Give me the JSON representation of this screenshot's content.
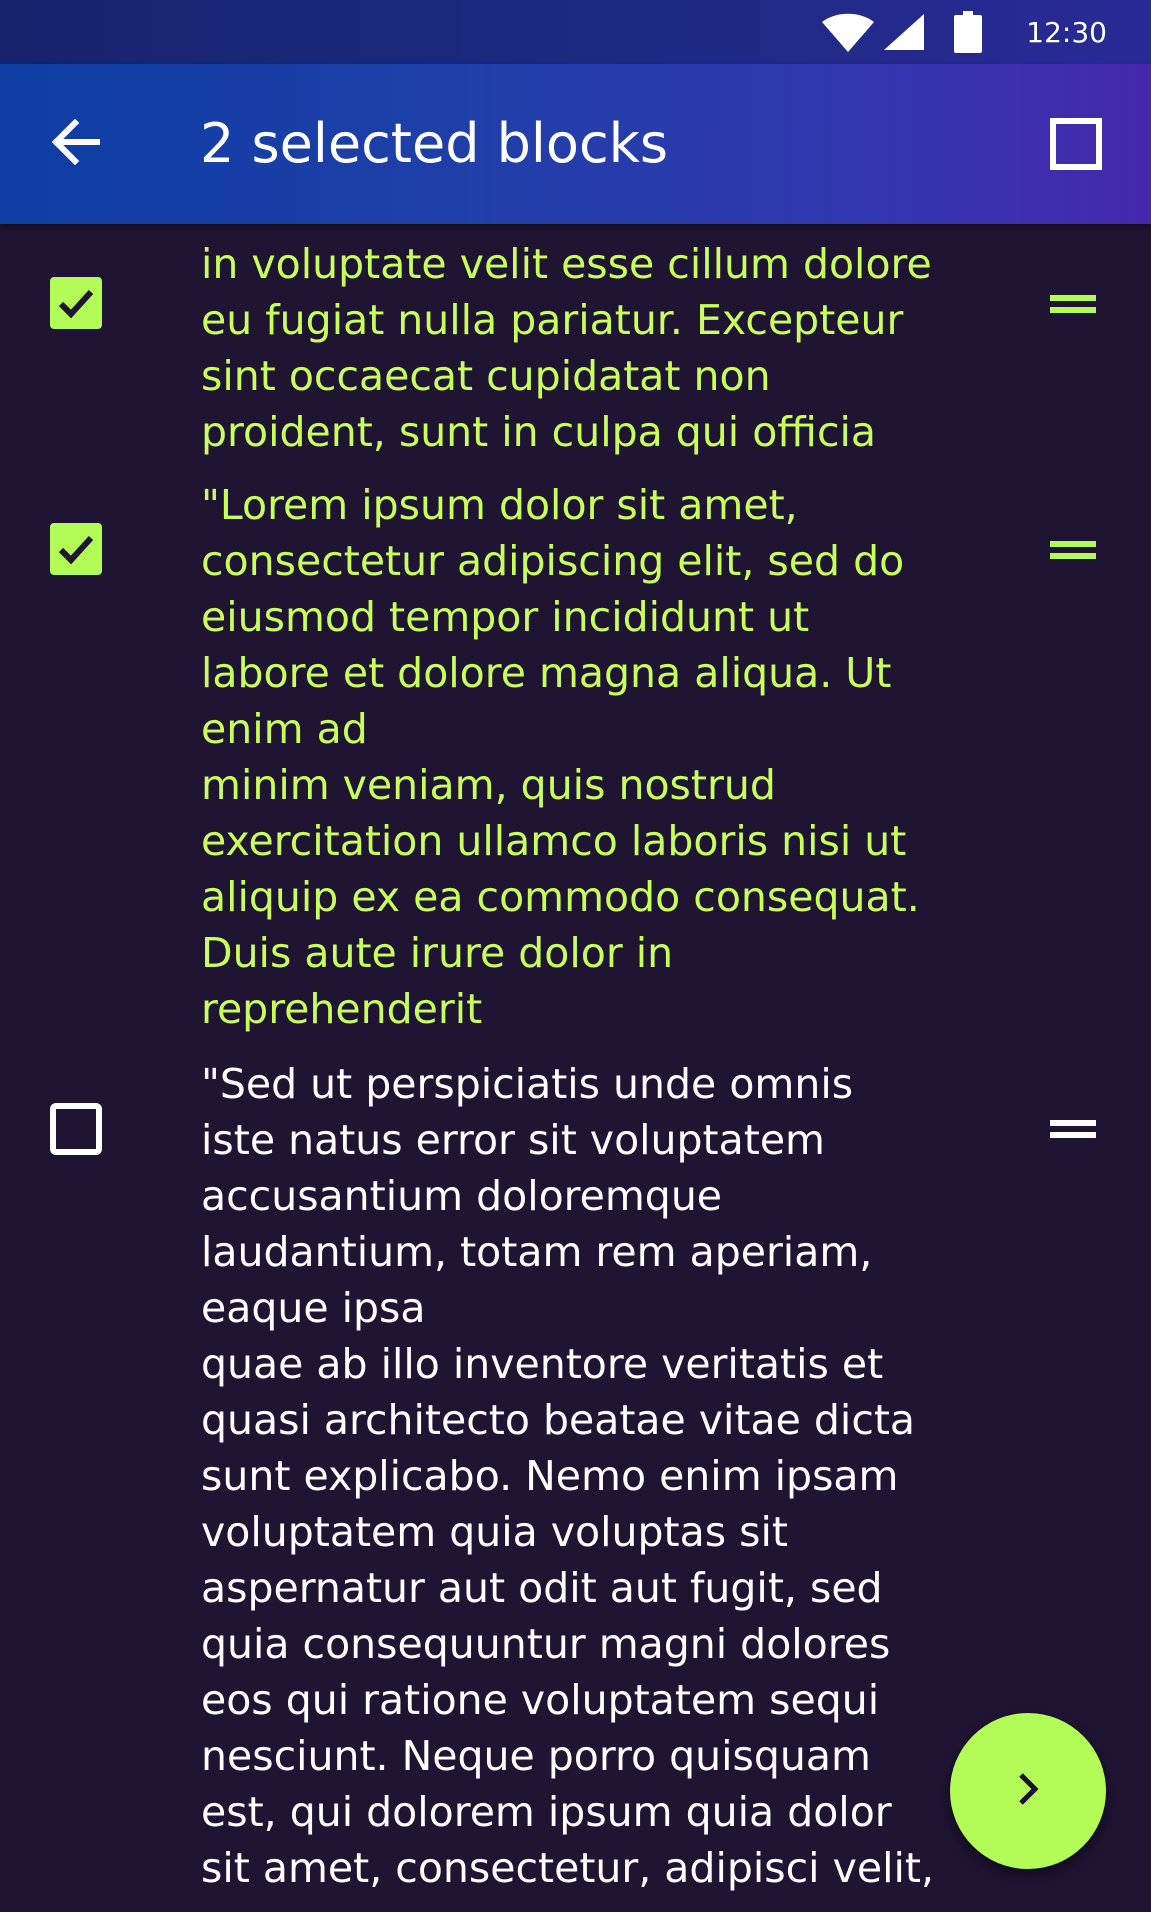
{
  "status_bar": {
    "time": "12:30",
    "icons": [
      "wifi-icon",
      "signal-icon",
      "battery-icon"
    ]
  },
  "app_bar": {
    "title": "2 selected blocks",
    "back_icon": "arrow-back-icon",
    "select_all_icon": "checkbox-outline-icon"
  },
  "blocks": [
    {
      "selected": true,
      "text": "in voluptate velit esse cillum dolore\neu fugiat nulla pariatur. Excepteur\nsint occaecat cupidatat non\nproident, sunt in culpa qui officia"
    },
    {
      "selected": true,
      "text": "\"Lorem ipsum dolor sit amet,\nconsectetur adipiscing elit, sed do\neiusmod tempor incididunt ut\nlabore et dolore magna aliqua. Ut\nenim ad\nminim veniam, quis nostrud\nexercitation ullamco laboris nisi ut\naliquip ex ea commodo consequat.\nDuis aute irure dolor in\nreprehenderit"
    },
    {
      "selected": false,
      "text": "\"Sed ut perspiciatis unde omnis\niste natus error sit voluptatem\naccusantium doloremque\nlaudantium, totam rem aperiam,\neaque ipsa\nquae ab illo inventore veritatis et\nquasi architecto beatae vitae dicta\nsunt explicabo. Nemo enim ipsam\nvoluptatem quia voluptas sit\naspernatur aut odit aut fugit, sed\nquia consequuntur magni dolores\neos qui ratione voluptatem sequi\nnesciunt. Neque porro quisquam\nest, qui dolorem ipsum quia dolor\nsit amet, consectetur, adipisci velit,"
    }
  ],
  "fab": {
    "icon": "chevron-right-icon"
  },
  "colors": {
    "background": "#201433",
    "accent": "#b3fb56",
    "selected_text": "#c8ff5a",
    "unselected_text": "#ffffff"
  }
}
